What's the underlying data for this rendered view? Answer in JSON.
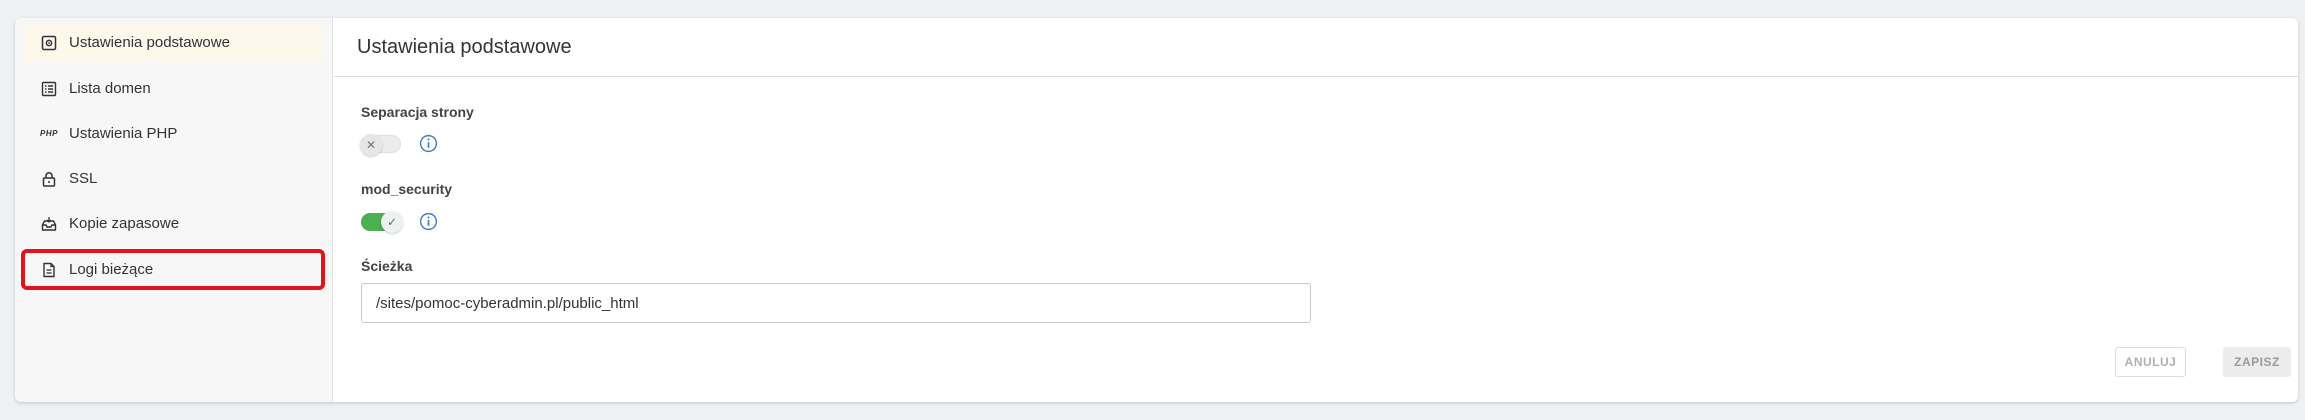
{
  "sidebar": {
    "items": [
      {
        "label": "Ustawienia podstawowe",
        "icon": "gear-icon",
        "active": true
      },
      {
        "label": "Lista domen",
        "icon": "list-icon"
      },
      {
        "label": "Ustawienia PHP",
        "icon": "php-icon",
        "icon_text": "PHP"
      },
      {
        "label": "SSL",
        "icon": "lock-icon"
      },
      {
        "label": "Kopie zapasowe",
        "icon": "backup-inbox-icon"
      },
      {
        "label": "Logi bieżące",
        "icon": "document-icon",
        "highlighted": true
      }
    ]
  },
  "main": {
    "title": "Ustawienia podstawowe",
    "fields": {
      "page_separation": {
        "label": "Separacja strony",
        "enabled": false
      },
      "mod_security": {
        "label": "mod_security",
        "enabled": true
      },
      "path": {
        "label": "Ścieżka",
        "value": "/sites/pomoc-cyberadmin.pl/public_html"
      }
    },
    "buttons": {
      "cancel": "ANULUJ",
      "save": "ZAPISZ"
    }
  },
  "colors": {
    "highlight_border": "#e0141b",
    "active_item_bg": "#fcf8ec",
    "toggle_on": "#4caf50",
    "info_icon": "#3b7fc4"
  }
}
